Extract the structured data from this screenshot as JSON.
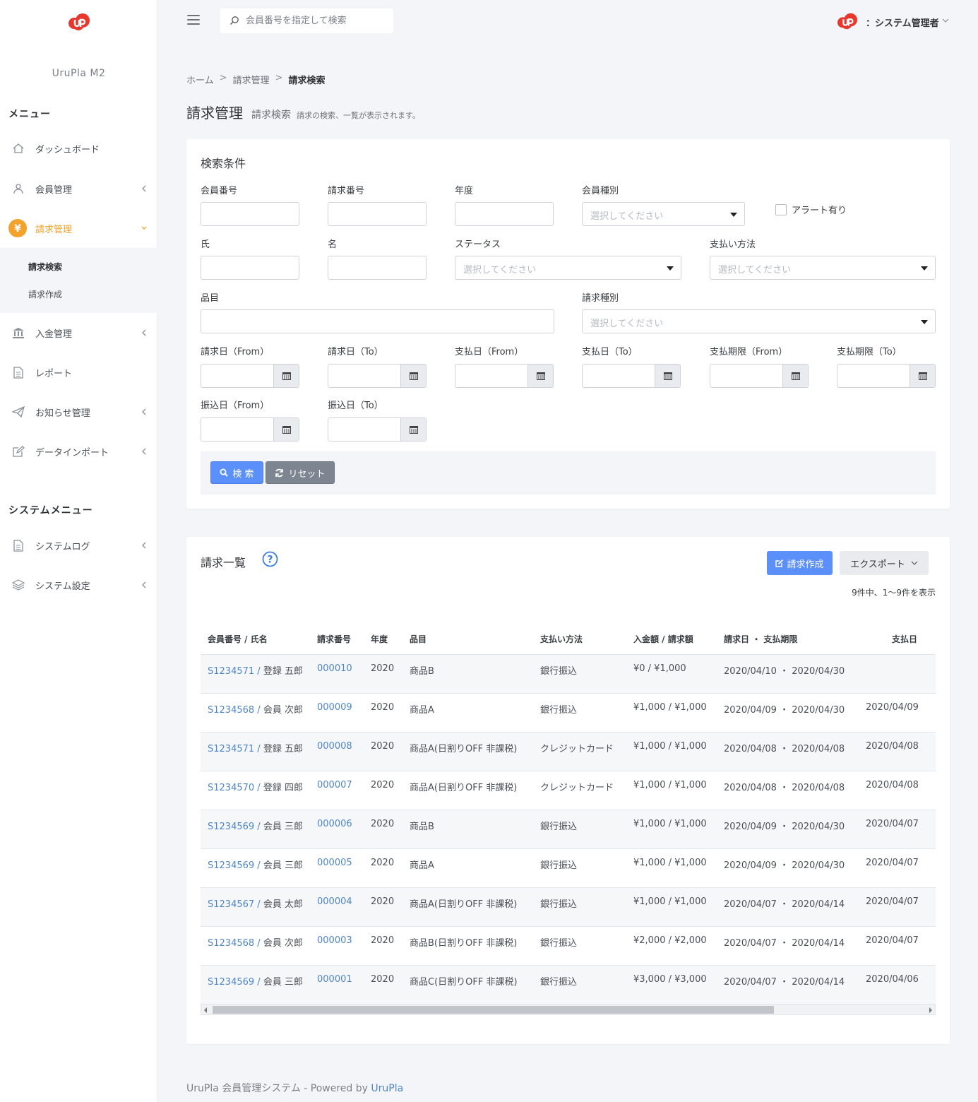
{
  "sidebar": {
    "brand": "UruPla M2",
    "menu_heading": "メニュー",
    "items": [
      {
        "label": "ダッシュボード"
      },
      {
        "label": "会員管理"
      },
      {
        "label": "請求管理"
      },
      {
        "label": "入金管理"
      },
      {
        "label": "レポート"
      },
      {
        "label": "お知らせ管理"
      },
      {
        "label": "データインポート"
      }
    ],
    "submenu": [
      {
        "label": "請求検索"
      },
      {
        "label": "請求作成"
      }
    ],
    "system_heading": "システムメニュー",
    "system_items": [
      {
        "label": "システムログ"
      },
      {
        "label": "システム設定"
      }
    ],
    "accent_color": "#f3a22c"
  },
  "topbar": {
    "search_placeholder": "会員番号を指定して検索",
    "user_name": "：システム管理者"
  },
  "breadcrumb": {
    "home": "ホーム",
    "sep": ">",
    "parent": "請求管理",
    "current": "請求検索"
  },
  "page": {
    "title": "請求管理",
    "subtitle": "請求検索",
    "description": "請求の検索、一覧が表示されます。"
  },
  "search": {
    "title": "検索条件",
    "fields": {
      "member_no": "会員番号",
      "invoice_no": "請求番号",
      "year": "年度",
      "member_type": "会員種別",
      "alert": "アラート有り",
      "last_name": "氏",
      "first_name": "名",
      "status": "ステータス",
      "payment_method": "支払い方法",
      "item": "品目",
      "invoice_type": "請求種別",
      "invoice_date_from": "請求日（From）",
      "invoice_date_to": "請求日（To）",
      "pay_date_from": "支払日（From）",
      "pay_date_to": "支払日（To）",
      "due_from": "支払期限（From）",
      "due_to": "支払期限（To）",
      "transfer_from": "振込日（From）",
      "transfer_to": "振込日（To）"
    },
    "select_placeholder": "選択してください",
    "search_button": "検 索",
    "reset_button": "リセット"
  },
  "list": {
    "title": "請求一覧",
    "create_button": "請求作成",
    "export_button": "エクスポート",
    "count_text": "9件中、1〜9件を表示",
    "columns": {
      "member": "会員番号 / 氏名",
      "invoice_no": "請求番号",
      "year": "年度",
      "item": "品目",
      "payment_method": "支払い方法",
      "amount": "入金額 / 請求額",
      "dates": "請求日 ・ 支払期限",
      "paid_date": "支払日"
    },
    "rows": [
      {
        "member_no": "S1234571",
        "name": "登録 五郎",
        "invoice_no": "000010",
        "year": "2020",
        "item": "商品B",
        "payment": "銀行振込",
        "amount": "¥0 / ¥1,000",
        "invoice_date": "2020/04/10",
        "due": "2020/04/30",
        "paid": ""
      },
      {
        "member_no": "S1234568",
        "name": "会員 次郎",
        "invoice_no": "000009",
        "year": "2020",
        "item": "商品A",
        "payment": "銀行振込",
        "amount": "¥1,000 / ¥1,000",
        "invoice_date": "2020/04/09",
        "due": "2020/04/30",
        "paid": "2020/04/09"
      },
      {
        "member_no": "S1234571",
        "name": "登録 五郎",
        "invoice_no": "000008",
        "year": "2020",
        "item": "商品A(日割りOFF 非課税)",
        "payment": "クレジットカード",
        "amount": "¥1,000 / ¥1,000",
        "invoice_date": "2020/04/08",
        "due": "2020/04/08",
        "paid": "2020/04/08"
      },
      {
        "member_no": "S1234570",
        "name": "登録 四郎",
        "invoice_no": "000007",
        "year": "2020",
        "item": "商品A(日割りOFF 非課税)",
        "payment": "クレジットカード",
        "amount": "¥1,000 / ¥1,000",
        "invoice_date": "2020/04/08",
        "due": "2020/04/08",
        "paid": "2020/04/08"
      },
      {
        "member_no": "S1234569",
        "name": "会員 三郎",
        "invoice_no": "000006",
        "year": "2020",
        "item": "商品B",
        "payment": "銀行振込",
        "amount": "¥1,000 / ¥1,000",
        "invoice_date": "2020/04/09",
        "due": "2020/04/30",
        "paid": "2020/04/07"
      },
      {
        "member_no": "S1234569",
        "name": "会員 三郎",
        "invoice_no": "000005",
        "year": "2020",
        "item": "商品A",
        "payment": "銀行振込",
        "amount": "¥1,000 / ¥1,000",
        "invoice_date": "2020/04/09",
        "due": "2020/04/30",
        "paid": "2020/04/07"
      },
      {
        "member_no": "S1234567",
        "name": "会員 太郎",
        "invoice_no": "000004",
        "year": "2020",
        "item": "商品A(日割りOFF 非課税)",
        "payment": "銀行振込",
        "amount": "¥1,000 / ¥1,000",
        "invoice_date": "2020/04/07",
        "due": "2020/04/14",
        "paid": "2020/04/07"
      },
      {
        "member_no": "S1234568",
        "name": "会員 次郎",
        "invoice_no": "000003",
        "year": "2020",
        "item": "商品B(日割りOFF 非課税)",
        "payment": "銀行振込",
        "amount": "¥2,000 / ¥2,000",
        "invoice_date": "2020/04/07",
        "due": "2020/04/14",
        "paid": "2020/04/07"
      },
      {
        "member_no": "S1234569",
        "name": "会員 三郎",
        "invoice_no": "000001",
        "year": "2020",
        "item": "商品C(日割りOFF 非課税)",
        "payment": "銀行振込",
        "amount": "¥3,000 / ¥3,000",
        "invoice_date": "2020/04/07",
        "due": "2020/04/14",
        "paid": "2020/04/06"
      }
    ]
  },
  "footer": {
    "prefix": "UruPla 会員管理システム - Powered by ",
    "link": "UruPla"
  }
}
